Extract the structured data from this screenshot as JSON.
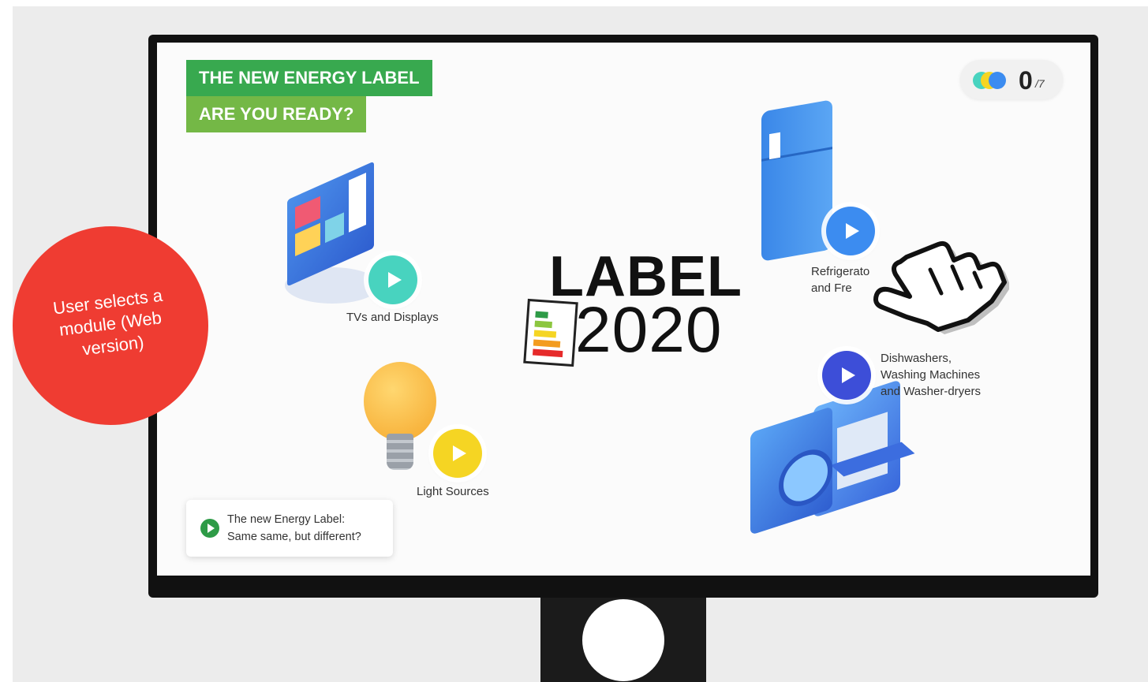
{
  "title": {
    "line1": "THE NEW ENERGY LABEL",
    "line2": "ARE YOU READY?"
  },
  "score": {
    "value": "0",
    "total": "/7"
  },
  "logo": {
    "word": "LABEL",
    "year": "2020"
  },
  "modules": {
    "tvs": {
      "label": "TVs and Displays",
      "color": "#48d3bf"
    },
    "lights": {
      "label": "Light Sources",
      "color": "#f5d523"
    },
    "fridges": {
      "line1": "Refrigerato",
      "line2": "and Fre",
      "color": "#3c8cf0"
    },
    "washers": {
      "line1": "Dishwashers,",
      "line2": "Washing Machines",
      "line3": "and Washer-dryers",
      "color": "#3d4ed8"
    }
  },
  "intro_card": {
    "line1": "The new Energy Label:",
    "line2": "Same same, but different?"
  },
  "annotation": {
    "line1": "User selects a",
    "line2": "module (Web",
    "line3": "version)"
  },
  "colors": {
    "green_dark": "#38a94f",
    "green_light": "#74b846",
    "annotation_red": "#ef3c32"
  }
}
